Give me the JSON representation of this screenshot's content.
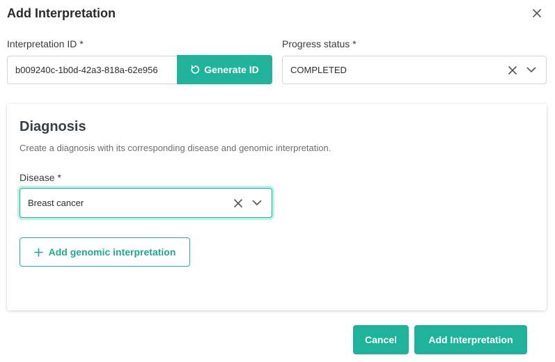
{
  "dialog": {
    "title": "Add Interpretation",
    "close_icon": "close-icon"
  },
  "interpretation_id": {
    "label": "Interpretation ID *",
    "value": "b009240c-1b0d-42a3-818a-62e956",
    "generate_button": {
      "label": "Generate ID",
      "icon": "refresh-icon"
    }
  },
  "progress_status": {
    "label": "Progress status *",
    "value": "COMPLETED",
    "clear_icon": "clear-icon",
    "dropdown_icon": "chevron-down-icon"
  },
  "diagnosis": {
    "title": "Diagnosis",
    "subtitle": "Create a diagnosis with its corresponding disease and genomic interpretation.",
    "disease": {
      "label": "Disease *",
      "value": "Breast cancer"
    },
    "add_genomic_button": {
      "label": "Add genomic interpretation",
      "icon": "plus-icon"
    }
  },
  "footer": {
    "cancel_label": "Cancel",
    "submit_label": "Add Interpretation"
  },
  "colors": {
    "accent": "#1fb39c",
    "focus_ring": "#2fe0c4",
    "border": "#cfd4d8"
  }
}
